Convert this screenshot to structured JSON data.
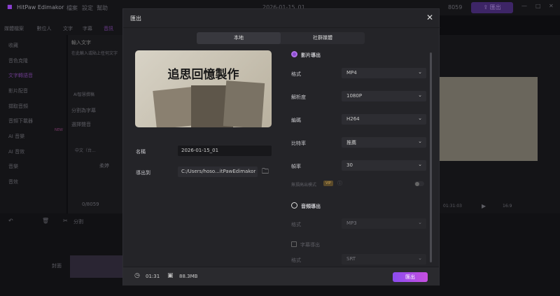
{
  "app": {
    "title": "HitPaw Edimakor",
    "menu": [
      "檔案",
      "設定",
      "幫助"
    ],
    "project_name": "2026-01-15_01",
    "credits": "8059",
    "export_label": "匯出"
  },
  "toolbar": [
    "媒體檔案",
    "數位人",
    "文字",
    "字幕",
    "音訊"
  ],
  "sidebar": [
    "收藏",
    "音色克隆",
    "文字轉語音",
    "影片配音",
    "擷取音頻",
    "音頻下載器",
    "AI 音樂",
    "AI 音效",
    "音樂",
    "音效"
  ],
  "sidebar_badge": "NEW",
  "tts_panel": {
    "step1": "輸入文字",
    "placeholder": "在此輸入或貼上任何文字",
    "ai_button": "AI智慧撰稿",
    "split_label": "分割為字幕",
    "step2": "選擇聲音",
    "language": "中文（台...",
    "voice_name": "柔婷",
    "credits": "0/8059"
  },
  "preview": {
    "time": "01:31:03",
    "ratio": "16:9"
  },
  "timeline": {
    "split_label": "分割",
    "track_label": "封面"
  },
  "dialog": {
    "title": "匯出",
    "tabs": [
      {
        "label": "本地",
        "active": true
      },
      {
        "label": "社群媒體",
        "active": false
      }
    ],
    "thumbnail_text": "追思回憶製作",
    "name_label": "名稱",
    "name_value": "2026-01-15_01",
    "path_label": "導出到",
    "path_value": "C:/Users/hoso...itPawEdimakor",
    "video_export": {
      "label": "影片導出",
      "checked": true,
      "fields": [
        {
          "label": "格式",
          "value": "MP4"
        },
        {
          "label": "解析度",
          "value": "1080P"
        },
        {
          "label": "編碼",
          "value": "H264"
        },
        {
          "label": "比特率",
          "value": "推薦"
        },
        {
          "label": "幀率",
          "value": "30"
        }
      ],
      "hd_label": "無損高出模式",
      "vip": "VIP"
    },
    "audio_export": {
      "label": "音頻導出",
      "checked": false,
      "format_label": "格式",
      "format_value": "MP3"
    },
    "subtitle_export": {
      "label": "字幕導出",
      "checked": false,
      "format_label": "格式",
      "format_value": "SRT"
    },
    "duration": "01:31",
    "size": "88.3MB",
    "export_button": "匯出"
  }
}
